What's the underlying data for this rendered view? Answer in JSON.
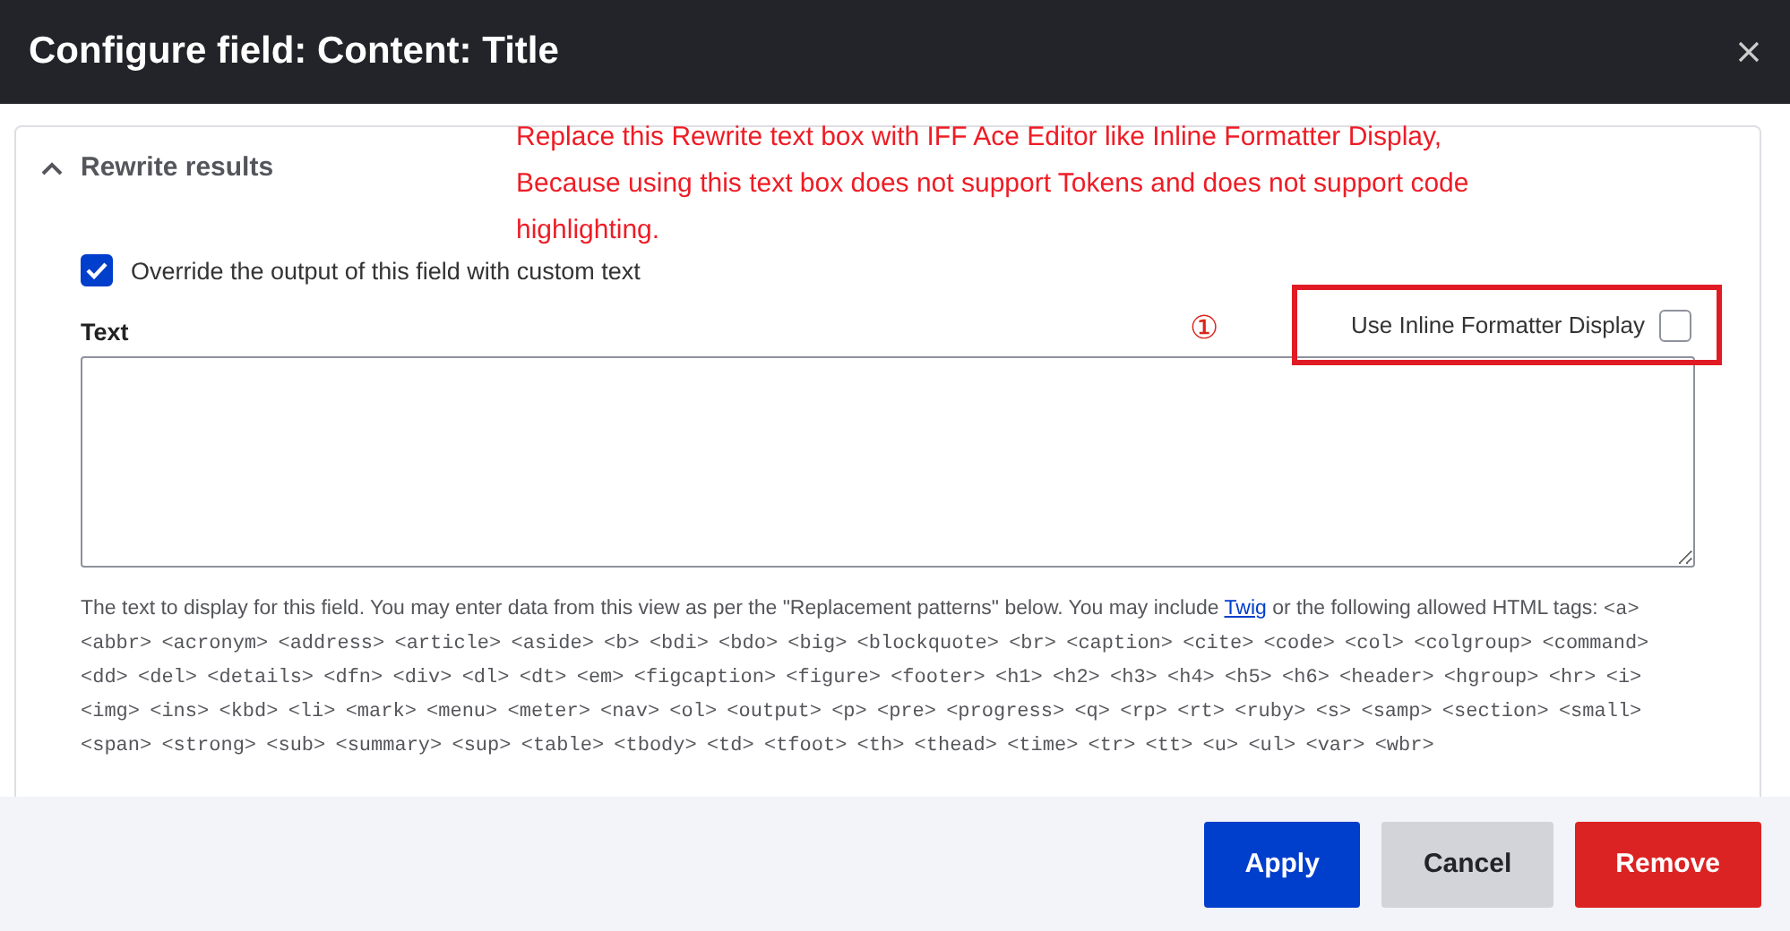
{
  "dialog": {
    "title": "Configure field: Content: Title"
  },
  "section": {
    "title": "Rewrite results",
    "expanded": true
  },
  "override": {
    "label": "Override the output of this field with custom text",
    "checked": true
  },
  "text_field": {
    "label": "Text"
  },
  "help": {
    "before": "The text to display for this field. You may enter data from this view as per the \"Replacement patterns\" below. You may include ",
    "link": "Twig",
    "after": " or the following allowed HTML tags: ",
    "tags": "<a> <abbr> <acronym> <address> <article> <aside> <b> <bdi> <bdo> <big> <blockquote> <br> <caption> <cite> <code> <col> <colgroup> <command> <dd> <del> <details> <dfn> <div> <dl> <dt> <em> <figcaption> <figure> <footer> <h1> <h2> <h3> <h4> <h5> <h6> <header> <hgroup> <hr> <i> <img> <ins> <kbd> <li> <mark> <menu> <meter> <nav> <ol> <output> <p> <pre> <progress> <q> <rp> <rt> <ruby> <s> <samp> <section> <small> <span> <strong> <sub> <summary> <sup> <table> <tbody> <td> <tfoot> <th> <thead> <time> <tr> <tt> <u> <ul> <var> <wbr>"
  },
  "annotation": {
    "lines": [
      "Replace this Rewrite text box with IFF Ace Editor like Inline Formatter Display,",
      "Because using this text box does not support Tokens and does not support code highlighting."
    ],
    "marker": "①"
  },
  "inline_formatter": {
    "label": "Use Inline Formatter Display",
    "checked": false
  },
  "buttons": [
    {
      "label": "Apply",
      "kind": "primary"
    },
    {
      "label": "Cancel",
      "kind": "secondary"
    },
    {
      "label": "Remove",
      "kind": "danger"
    }
  ]
}
